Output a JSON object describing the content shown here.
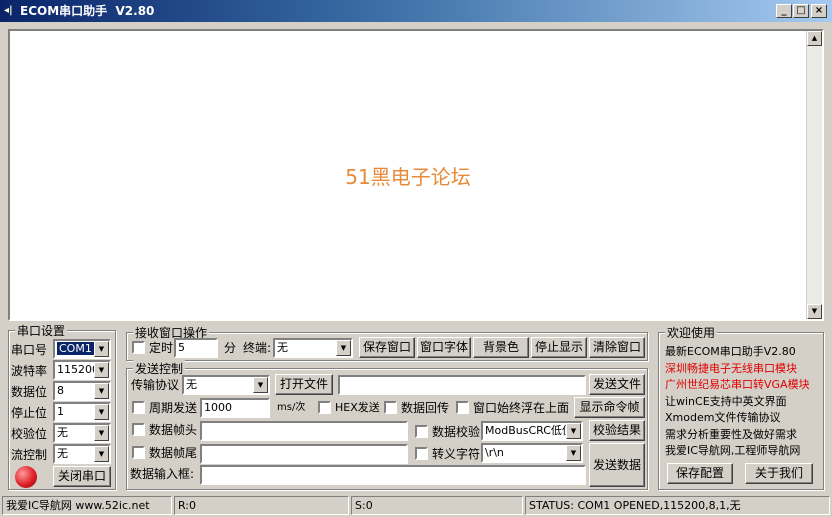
{
  "window": {
    "title": "ECOM串口助手  V2.80",
    "app_icon": "serial-app-icon",
    "minimize": "_",
    "maximize": "□",
    "close": "×"
  },
  "receive": {
    "watermark_prefix": "51",
    "watermark_text": "黑电子论坛"
  },
  "serial": {
    "title": "串口设置",
    "port_label": "串口号",
    "port_value": "COM1",
    "baud_label": "波特率",
    "baud_value": "115200",
    "data_bits_label": "数据位",
    "data_bits_value": "8",
    "stop_bits_label": "停止位",
    "stop_bits_value": "1",
    "parity_label": "校验位",
    "parity_value": "无",
    "flow_label": "流控制",
    "flow_value": "无",
    "close_port_btn": "关闭串口",
    "led_color": "#e0202a"
  },
  "recvops": {
    "title": "接收窗口操作",
    "timer_label": "定时",
    "timer_value": "5",
    "unit_min": "分",
    "terminal_label": "终端:",
    "terminal_value": "无",
    "save_window_btn": "保存窗口",
    "window_font_btn": "窗口字体",
    "bgcolor_btn": "背景色",
    "stop_display_btn": "停止显示",
    "clear_window_btn": "清除窗口"
  },
  "send": {
    "title": "发送控制",
    "protocol_label": "传输协议",
    "protocol_value": "无",
    "open_file_btn": "打开文件",
    "file_path": "",
    "send_file_btn": "发送文件",
    "period_label": "周期发送",
    "period_value": "1000",
    "period_unit": "ms/次",
    "hex_send_label": "HEX发送",
    "echo_label": "数据回传",
    "float_label": "窗口始终浮在上面",
    "show_cmd_btn": "显示命令帧",
    "header_label": "数据帧头",
    "header_value": "",
    "checksum_label": "数据校验",
    "checksum_value": "ModBusCRC低位?",
    "check_result_btn": "校验结果",
    "tail_label": "数据帧尾",
    "tail_value": "",
    "escape_label": "转义字符",
    "escape_value": "\\r\\n",
    "input_label": "数据输入框:",
    "input_value": "",
    "send_data_btn": "发送数据"
  },
  "welcome": {
    "title": "欢迎使用",
    "lines": [
      {
        "text": "最新ECOM串口助手V2.80",
        "color": "#000000"
      },
      {
        "text": "深圳畅捷电子无线串口模块",
        "color": "#e00000"
      },
      {
        "text": "广州世纪易芯串口转VGA模块",
        "color": "#e00000"
      },
      {
        "text": "让winCE支持中英文界面",
        "color": "#000000"
      },
      {
        "text": "Xmodem文件传输协议",
        "color": "#000000"
      },
      {
        "text": "需求分析重要性及做好需求",
        "color": "#000000"
      },
      {
        "text": "我爱IC导航网,工程师导航网",
        "color": "#000000"
      }
    ],
    "save_config_btn": "保存配置",
    "about_btn": "关于我们"
  },
  "statusbar": {
    "site": "我爱IC导航网 www.52ic.net",
    "rx": "R:0",
    "tx": "S:0",
    "status": "STATUS: COM1 OPENED,115200,8,1,无"
  }
}
